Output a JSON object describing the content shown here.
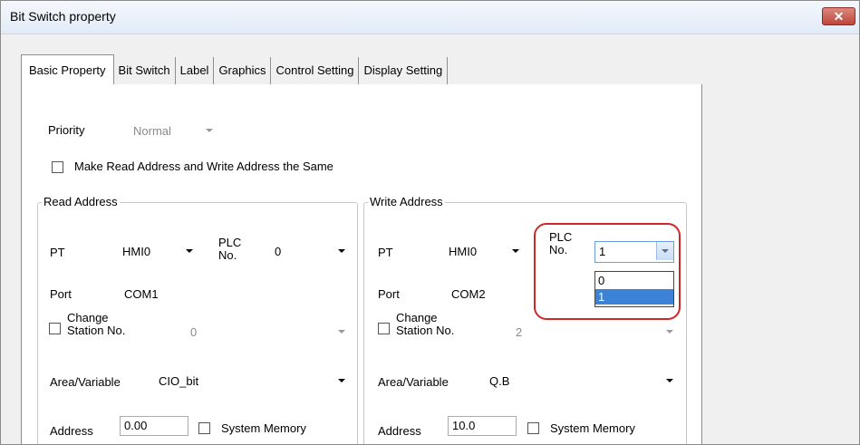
{
  "window": {
    "title": "Bit Switch property",
    "close_label": "✕"
  },
  "tabs": [
    {
      "label": "Basic Property",
      "active": true
    },
    {
      "label": "Bit Switch",
      "active": false
    },
    {
      "label": "Label",
      "active": false
    },
    {
      "label": "Graphics",
      "active": false
    },
    {
      "label": "Control Setting",
      "active": false
    },
    {
      "label": "Display Setting",
      "active": false
    }
  ],
  "priority": {
    "label": "Priority",
    "value": "Normal"
  },
  "same_address": {
    "label": "Make Read Address and Write Address the Same",
    "checked": false
  },
  "read_address": {
    "legend": "Read Address",
    "pt_label": "PT",
    "pt_value": "HMI0",
    "plc_label_1": "PLC",
    "plc_label_2": "No.",
    "plc_value": "0",
    "port_label": "Port",
    "port_value": "COM1",
    "change_station_1": "Change",
    "change_station_2": "Station No.",
    "station_value": "0",
    "area_label": "Area/Variable",
    "area_value": "CIO_bit",
    "address_label": "Address",
    "address_value": "0.00",
    "system_memory_label": "System Memory"
  },
  "write_address": {
    "legend": "Write Address",
    "pt_label": "PT",
    "pt_value": "HMI0",
    "plc_label_1": "PLC",
    "plc_label_2": "No.",
    "plc_value": "1",
    "plc_options": [
      "0",
      "1"
    ],
    "plc_selected_index": 1,
    "port_label": "Port",
    "port_value": "COM2",
    "change_station_1": "Change",
    "change_station_2": "Station No.",
    "station_value": "2",
    "area_label": "Area/Variable",
    "area_value": "Q.B",
    "address_label": "Address",
    "address_value": "10.0",
    "system_memory_label": "System Memory"
  },
  "colors": {
    "highlight": "#d02828",
    "selection": "#3c82d6"
  }
}
